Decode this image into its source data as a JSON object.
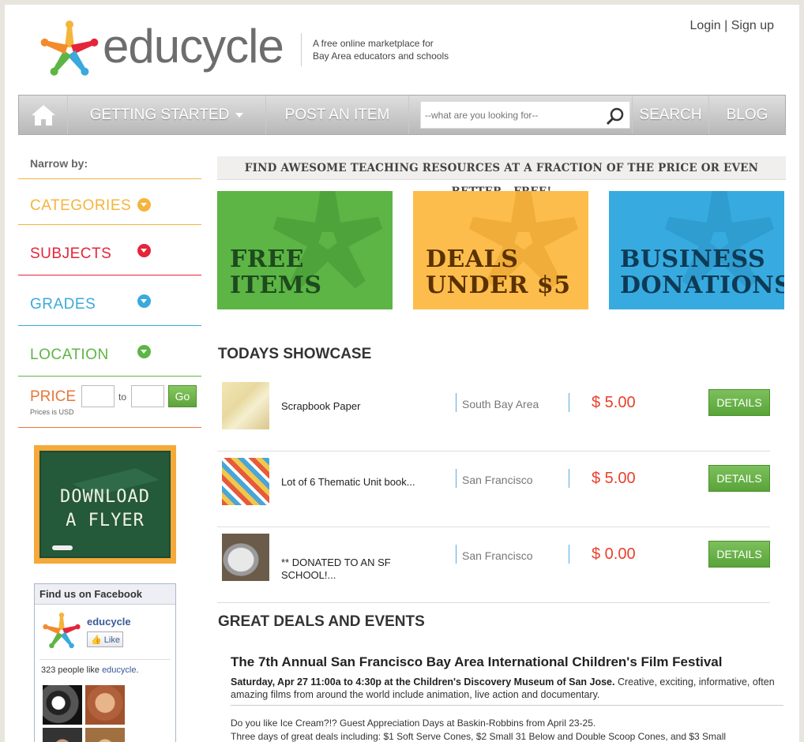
{
  "header": {
    "brand": "educycle",
    "tagline_line1": "A free online marketplace for",
    "tagline_line2": "Bay Area educators and schools",
    "login": "Login",
    "separator": "|",
    "signup": "Sign up"
  },
  "nav": {
    "home_icon": "home-icon",
    "getting_started": "GETTING STARTED",
    "post_item": "POST AN ITEM",
    "search_placeholder": "--what are you looking for--",
    "search_label": "SEARCH",
    "blog": "BLOG"
  },
  "sidebar": {
    "narrow_by": "Narrow by:",
    "filters": [
      {
        "label": "CATEGORIES",
        "color": "#f5b43c"
      },
      {
        "label": "SUBJECTS",
        "color": "#e5253a"
      },
      {
        "label": "GRADES",
        "color": "#3aa9dc"
      },
      {
        "label": "LOCATION",
        "color": "#5cb544"
      }
    ],
    "price_label": "PRICE",
    "price_to": "to",
    "go": "Go",
    "price_note": "Prices is USD",
    "flyer_line1": "DOWNLOAD",
    "flyer_line2": "A FLYER"
  },
  "facebook": {
    "heading": "Find us on Facebook",
    "page_name": "educycle",
    "like_button": "Like",
    "count_text": "323 people like ",
    "count_link": "educycle",
    "count_suffix": "."
  },
  "main": {
    "banner": "FIND AWESOME TEACHING RESOURCES AT A FRACTION OF THE PRICE OR EVEN BETTER...FREE!",
    "promos": [
      {
        "line1": "FREE",
        "line2": "ITEMS",
        "text_color": "#1e4a1f"
      },
      {
        "line1": "DEALS",
        "line2": "UNDER $5",
        "text_color": "#5a3100"
      },
      {
        "line1": "BUSINESS",
        "line2": "DONATIONS",
        "text_color": "#0e3a55"
      }
    ],
    "showcase_title": "TODAYS SHOWCASE",
    "items": [
      {
        "name": "Scrapbook Paper",
        "location": "South Bay Area",
        "price": "$ 5.00",
        "button": "DETAILS"
      },
      {
        "name": "Lot of 6 Thematic Unit book...",
        "location": "San Francisco",
        "price": "$ 5.00",
        "button": "DETAILS"
      },
      {
        "name": "** DONATED TO AN SF SCHOOL!...",
        "location": "San Francisco",
        "price": "$ 0.00",
        "button": "DETAILS"
      }
    ],
    "deals_title": "GREAT DEALS AND EVENTS",
    "event1_title": "The 7th Annual San Francisco Bay Area International Children's Film Festival",
    "event1_bold": "Saturday, Apr 27 11:00a to 4:30p at the Children's Discovery Museum of San Jose.",
    "event1_text": " Creative, exciting, informative, often amazing films from around the world include animation, live action and documentary.",
    "event2_line1": "Do you like Ice Cream?!?  Guest Appreciation Days at Baskin-Robbins from April 23-25.",
    "event2_line2": "Three days of great deals including: $1 Soft Serve Cones, $2 Small 31 Below and Double Scoop Cones, and $3 Small"
  },
  "colors": {
    "green": "#5cb544",
    "orange": "#fdbd4c",
    "blue": "#37abe0",
    "red": "#e5253a",
    "price_red": "#e8402c"
  }
}
